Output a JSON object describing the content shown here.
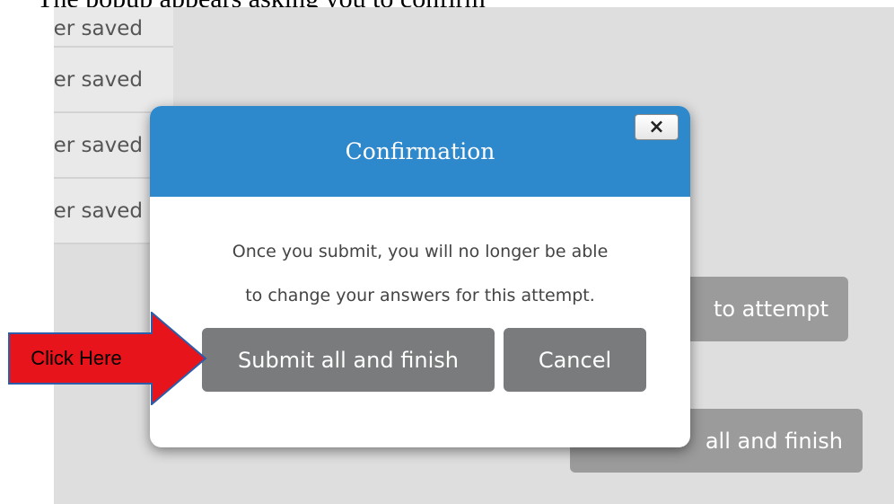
{
  "document": {
    "caption": "The popup appears asking you to confirm"
  },
  "background": {
    "status_items": [
      "ver saved",
      "ver saved",
      "ver saved",
      "ver saved"
    ],
    "return_button_label": "to attempt",
    "submit_button_label": "all and finish"
  },
  "dialog": {
    "title": "Confirmation",
    "close_label": "×",
    "message_line1": "Once you submit, you will no longer be able",
    "message_line2": "to change your answers for this attempt.",
    "submit_label": "Submit all and finish",
    "cancel_label": "Cancel"
  },
  "annotation": {
    "label": "Click Here",
    "arrow_color": "#e8141b",
    "arrow_border": "#2b5dab"
  },
  "colors": {
    "header": "#2e88cc",
    "button": "#7a7b7c",
    "background_button": "#9b9b9b",
    "overlay": "#dedede"
  }
}
